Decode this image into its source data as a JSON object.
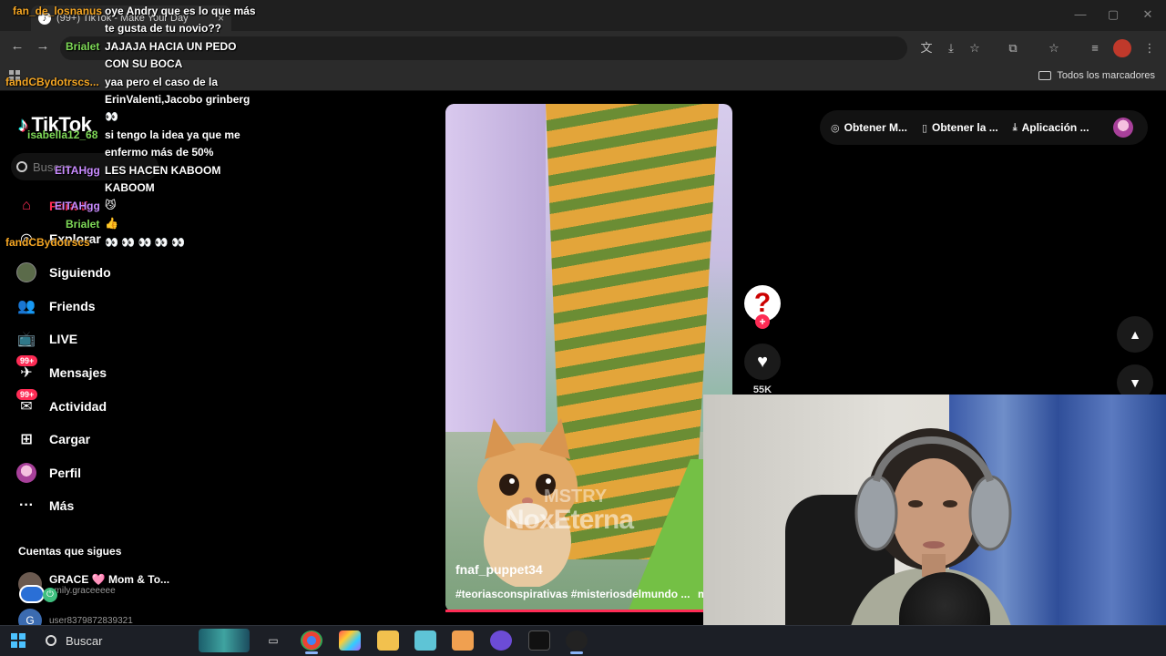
{
  "browser": {
    "tab_title": "(99+) TikTok - Make Your Day",
    "tab_close": "×",
    "minimize": "—",
    "maximize": "▢",
    "close": "✕",
    "bookmarks_all": "Todos los marcadores"
  },
  "tiktok": {
    "logo": "TikTok",
    "search_placeholder": "Buscar",
    "nav": [
      {
        "label": "Para ti",
        "icon": "home-icon"
      },
      {
        "label": "Explorar",
        "icon": "compass-icon"
      },
      {
        "label": "Siguiendo",
        "icon": "following-avatar"
      },
      {
        "label": "Friends",
        "icon": "friends-icon"
      },
      {
        "label": "LIVE",
        "icon": "live-icon"
      },
      {
        "label": "Mensajes",
        "icon": "messages-icon",
        "badge": "99+"
      },
      {
        "label": "Actividad",
        "icon": "activity-icon",
        "badge": "99+"
      },
      {
        "label": "Cargar",
        "icon": "upload-icon"
      },
      {
        "label": "Perfil",
        "icon": "profile-avatar"
      },
      {
        "label": "Más",
        "icon": "more-icon"
      }
    ],
    "following_title": "Cuentas que sigues",
    "accounts": [
      {
        "name": "GRACE 🩷 Mom & To...",
        "handle": "emily.graceeeee"
      },
      {
        "name": "",
        "handle": "user8379872839321"
      }
    ],
    "top_actions": [
      "Obtener M...",
      "Obtener la ...",
      "Aplicación ..."
    ],
    "video": {
      "username": "fnaf_puppet34",
      "tags": "#teoriasconspirativas #misteriosdelmundo ...",
      "more": "m",
      "watermark": "NoxEterna",
      "watermark_small": "MSTRY"
    },
    "like_count": "55K"
  },
  "chat": [
    {
      "user": "fan_de_losnanus",
      "color": "#f5a623",
      "msg": [
        "oye Andry que es lo que más",
        "te gusta de tu novio??"
      ]
    },
    {
      "user": "Brialet",
      "color": "#7ed957",
      "msg": [
        "JAJAJA HACIA UN PEDO",
        "CON SU BOCA"
      ]
    },
    {
      "user": "fandCBydotrscs...",
      "color": "#f5a623",
      "msg": [
        "yaa pero el caso de la",
        "ErinValenti,Jacobo grinberg",
        "👀"
      ]
    },
    {
      "user": "isabella12_68",
      "color": "#7ed957",
      "msg": [
        "si tengo la idea ya que me",
        "enfermo más de 50%"
      ]
    },
    {
      "user": "EITAHgg",
      "color": "#c98bff",
      "msg": [
        "LES HACEN KABOOM",
        "KABOOM"
      ]
    },
    {
      "user": "EITAHgg",
      "color": "#c98bff",
      "msg": [
        "😼"
      ]
    },
    {
      "user": "Brialet",
      "color": "#7ed957",
      "msg": [
        "👍"
      ]
    },
    {
      "user": "fandCBydotrscs",
      "color": "#f5a623",
      "msg": [
        "👀 👀 👀 👀 👀"
      ]
    }
  ],
  "taskbar": {
    "search": "Buscar"
  },
  "colors": {
    "accent": "#fe2c55",
    "chat_orange": "#f5a623",
    "chat_green": "#7ed957",
    "chat_purple": "#c98bff"
  }
}
